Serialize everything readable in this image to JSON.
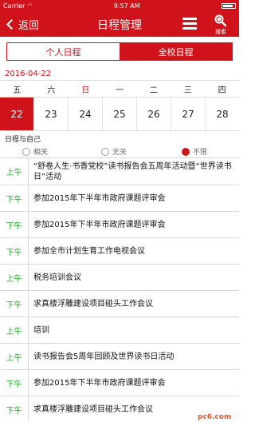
{
  "status_bar": {
    "carrier": "Carrier",
    "time": "9:57 AM",
    "wifi_icon": "wifi-icon",
    "battery_icon": "battery-icon"
  },
  "nav": {
    "back_label": "返回",
    "title": "日程管理",
    "menu_icon": "hamburger-menu-icon",
    "search_label": "搜索",
    "accent_color": "#d0121b"
  },
  "tabs": [
    {
      "label": "个人日程",
      "active": false
    },
    {
      "label": "全校日程",
      "active": true
    }
  ],
  "calendar": {
    "date": "2016-04-22",
    "weekdays": [
      "五",
      "六",
      "日",
      "一",
      "二",
      "三",
      "四"
    ],
    "days": [
      "22",
      "23",
      "24",
      "25",
      "26",
      "27",
      "28"
    ],
    "selected_day": "22"
  },
  "filter": {
    "title": "日程与自己",
    "options": [
      "相关",
      "无关",
      "不限"
    ],
    "selected": "不限"
  },
  "events": [
    {
      "time": "上午",
      "title": "“舒卷人生·书香党校”读书报告会五周年活动暨“世界读书日”活动"
    },
    {
      "time": "下午",
      "title": "参加2015年下半年市政府课题评审会"
    },
    {
      "time": "下午",
      "title": "参加2015年下半年市政府课题评审会"
    },
    {
      "time": "下午",
      "title": "参加全市计划生育工作电视会议"
    },
    {
      "time": "上午",
      "title": "税务培训会议"
    },
    {
      "time": "下午",
      "title": "求真楼浮雕建设项目碰头工作会议"
    },
    {
      "time": "上午",
      "title": "培训"
    },
    {
      "time": "上午",
      "title": "读书报告会5周年回顾及世界读书日活动"
    },
    {
      "time": "下午",
      "title": "参加2015年下半年市政府课题评审会"
    },
    {
      "time": "下午",
      "title": "求真楼浮雕建设项目碰头工作会议"
    }
  ],
  "watermark": "pc6.com",
  "time_color": "#2aa52e"
}
